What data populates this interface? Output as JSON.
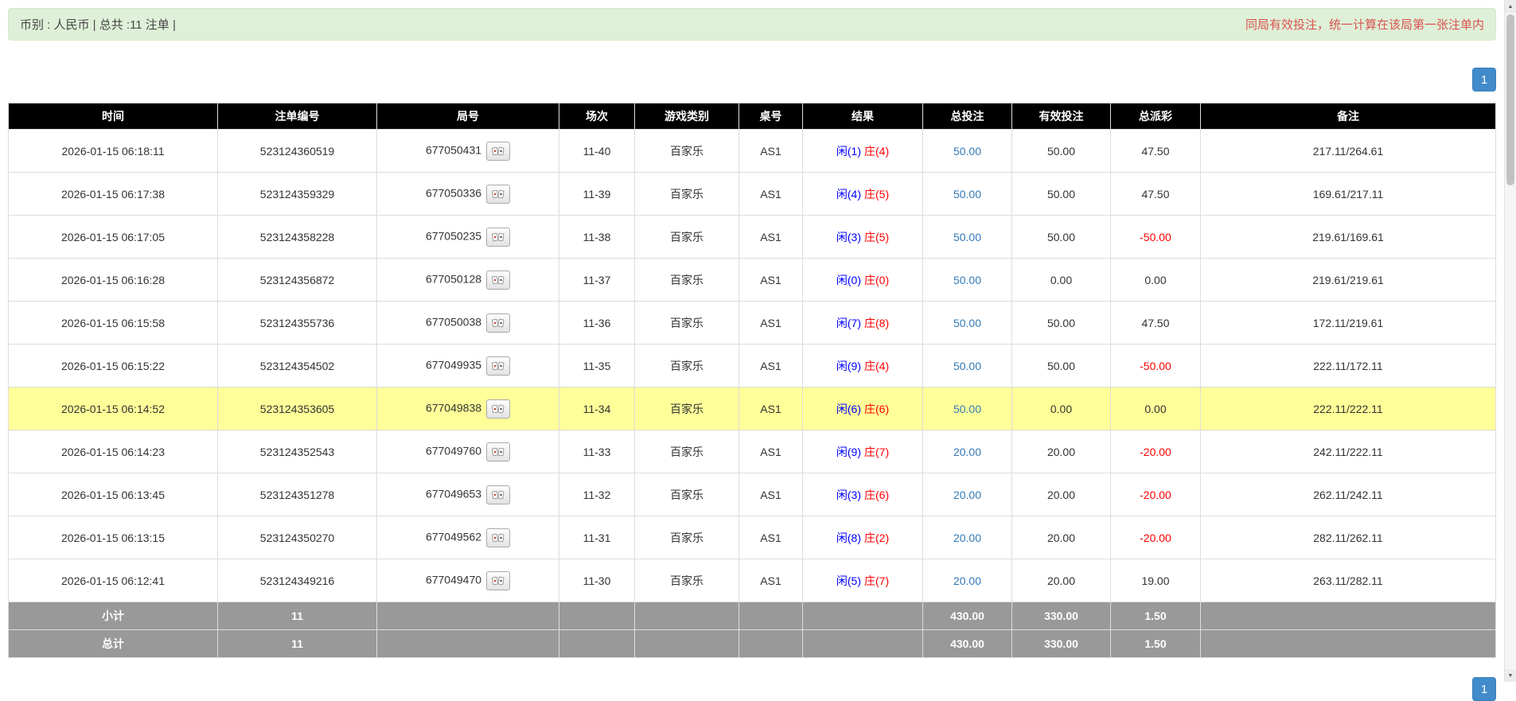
{
  "info_bar": {
    "left_text": "币别 : 人民币 | 总共 :11 注单 |",
    "right_notice": "同局有效投注，统一计算在该局第一张注单内"
  },
  "pagination": {
    "current_page": "1"
  },
  "table": {
    "columns": [
      "时间",
      "注单编号",
      "局号",
      "场次",
      "游戏类别",
      "桌号",
      "结果",
      "总投注",
      "有效投注",
      "总派彩",
      "备注"
    ],
    "rows": [
      {
        "time": "2026-01-15 06:18:11",
        "bet_id": "523124360519",
        "round": "677050431",
        "session": "11-40",
        "game": "百家乐",
        "table_no": "AS1",
        "player": "闲(1)",
        "banker": "庄(4)",
        "total_bet": "50.00",
        "valid_bet": "50.00",
        "payout": "47.50",
        "remark": "217.11/264.61",
        "highlighted": false
      },
      {
        "time": "2026-01-15 06:17:38",
        "bet_id": "523124359329",
        "round": "677050336",
        "session": "11-39",
        "game": "百家乐",
        "table_no": "AS1",
        "player": "闲(4)",
        "banker": "庄(5)",
        "total_bet": "50.00",
        "valid_bet": "50.00",
        "payout": "47.50",
        "remark": "169.61/217.11",
        "highlighted": false
      },
      {
        "time": "2026-01-15 06:17:05",
        "bet_id": "523124358228",
        "round": "677050235",
        "session": "11-38",
        "game": "百家乐",
        "table_no": "AS1",
        "player": "闲(3)",
        "banker": "庄(5)",
        "total_bet": "50.00",
        "valid_bet": "50.00",
        "payout": "-50.00",
        "remark": "219.61/169.61",
        "highlighted": false
      },
      {
        "time": "2026-01-15 06:16:28",
        "bet_id": "523124356872",
        "round": "677050128",
        "session": "11-37",
        "game": "百家乐",
        "table_no": "AS1",
        "player": "闲(0)",
        "banker": "庄(0)",
        "total_bet": "50.00",
        "valid_bet": "0.00",
        "payout": "0.00",
        "remark": "219.61/219.61",
        "highlighted": false
      },
      {
        "time": "2026-01-15 06:15:58",
        "bet_id": "523124355736",
        "round": "677050038",
        "session": "11-36",
        "game": "百家乐",
        "table_no": "AS1",
        "player": "闲(7)",
        "banker": "庄(8)",
        "total_bet": "50.00",
        "valid_bet": "50.00",
        "payout": "47.50",
        "remark": "172.11/219.61",
        "highlighted": false
      },
      {
        "time": "2026-01-15 06:15:22",
        "bet_id": "523124354502",
        "round": "677049935",
        "session": "11-35",
        "game": "百家乐",
        "table_no": "AS1",
        "player": "闲(9)",
        "banker": "庄(4)",
        "total_bet": "50.00",
        "valid_bet": "50.00",
        "payout": "-50.00",
        "remark": "222.11/172.11",
        "highlighted": false
      },
      {
        "time": "2026-01-15 06:14:52",
        "bet_id": "523124353605",
        "round": "677049838",
        "session": "11-34",
        "game": "百家乐",
        "table_no": "AS1",
        "player": "闲(6)",
        "banker": "庄(6)",
        "total_bet": "50.00",
        "valid_bet": "0.00",
        "payout": "0.00",
        "remark": "222.11/222.11",
        "highlighted": true
      },
      {
        "time": "2026-01-15 06:14:23",
        "bet_id": "523124352543",
        "round": "677049760",
        "session": "11-33",
        "game": "百家乐",
        "table_no": "AS1",
        "player": "闲(9)",
        "banker": "庄(7)",
        "total_bet": "20.00",
        "valid_bet": "20.00",
        "payout": "-20.00",
        "remark": "242.11/222.11",
        "highlighted": false
      },
      {
        "time": "2026-01-15 06:13:45",
        "bet_id": "523124351278",
        "round": "677049653",
        "session": "11-32",
        "game": "百家乐",
        "table_no": "AS1",
        "player": "闲(3)",
        "banker": "庄(6)",
        "total_bet": "20.00",
        "valid_bet": "20.00",
        "payout": "-20.00",
        "remark": "262.11/242.11",
        "highlighted": false
      },
      {
        "time": "2026-01-15 06:13:15",
        "bet_id": "523124350270",
        "round": "677049562",
        "session": "11-31",
        "game": "百家乐",
        "table_no": "AS1",
        "player": "闲(8)",
        "banker": "庄(2)",
        "total_bet": "20.00",
        "valid_bet": "20.00",
        "payout": "-20.00",
        "remark": "282.11/262.11",
        "highlighted": false
      },
      {
        "time": "2026-01-15 06:12:41",
        "bet_id": "523124349216",
        "round": "677049470",
        "session": "11-30",
        "game": "百家乐",
        "table_no": "AS1",
        "player": "闲(5)",
        "banker": "庄(7)",
        "total_bet": "20.00",
        "valid_bet": "20.00",
        "payout": "19.00",
        "remark": "263.11/282.11",
        "highlighted": false
      }
    ],
    "footer": [
      {
        "label": "小计",
        "count": "11",
        "total_bet": "430.00",
        "valid_bet": "330.00",
        "payout": "1.50"
      },
      {
        "label": "总计",
        "count": "11",
        "total_bet": "430.00",
        "valid_bet": "330.00",
        "payout": "1.50"
      }
    ]
  },
  "icons": {
    "round_result_icon": "cards-icon",
    "scroll_up": "▲",
    "scroll_down": "▼"
  },
  "colors": {
    "info_bar_bg": "#dff0d8",
    "info_bar_border": "#d6e9c6",
    "notice_red": "#d9534f",
    "header_bg": "#000000",
    "footer_bg": "#999999",
    "highlight_row": "#ffff99",
    "bet_link_blue": "#337ab7",
    "player_blue": "#0000ff",
    "banker_red": "#ff0000",
    "negative_red": "#ff0000",
    "pagination_active": "#428bca"
  }
}
